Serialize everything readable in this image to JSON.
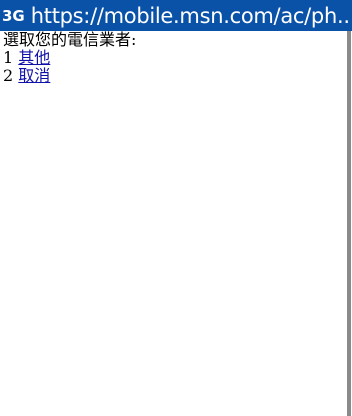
{
  "status_bar": {
    "network": "3G",
    "url": "https://mobile.msn.com/ac/ph..."
  },
  "page": {
    "prompt": "選取您的電信業者:",
    "options": [
      {
        "number": "1",
        "label": "其他"
      },
      {
        "number": "2",
        "label": "取消"
      }
    ]
  },
  "colors": {
    "status_bar_bg": "#0a52a8",
    "link": "#1111aa",
    "scrollbar": "#8a8a8a"
  },
  "icons": {
    "secure": "lock-icon"
  }
}
